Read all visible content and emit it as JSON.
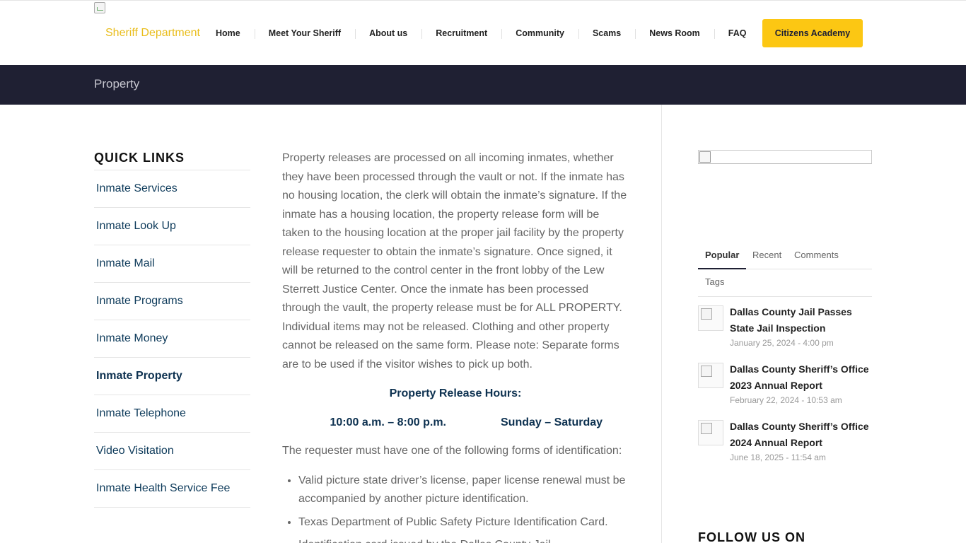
{
  "header": {
    "logo_text": "Sheriff Department",
    "nav": [
      "Home",
      "Meet Your Sheriff",
      "About us",
      "Recruitment",
      "Community",
      "Scams",
      "News Room",
      "FAQ"
    ],
    "cta_label": "Citizens Academy",
    "accent_color": "#fcc713"
  },
  "titlebar": {
    "title": "Property",
    "background": "#1f2033"
  },
  "quick_links": {
    "heading": "QUICK LINKS",
    "items": [
      "Inmate Services",
      "Inmate Look Up",
      "Inmate Mail",
      "Inmate Programs",
      "Inmate Money",
      "Inmate Property",
      "Inmate Telephone",
      "Video Visitation",
      "Inmate Health Service Fee"
    ],
    "active": "Inmate Property"
  },
  "content": {
    "intro": "Property releases are processed on all incoming inmates, whether they have been processed through the vault or not. If the inmate has no housing location, the clerk will obtain the inmate’s signature. If the inmate has a housing location, the property release form will be taken to the housing location at the proper jail facility by the property release requester to obtain the inmate’s signature. Once signed, it will be returned to the control center in the front lobby of the Lew Sterrett Justice Center. Once the inmate has been processed through the vault, the property release must be for ALL PROPERTY. Individual items may not be released. Clothing and other property cannot be released on the same form. Please note: Separate forms are to be used if the visitor wishes to pick up both.",
    "hours_title": "Property Release Hours:",
    "hours_time": "10:00 a.m. – 8:00 p.m.",
    "hours_days": "Sunday – Saturday",
    "requirement": "The requester must have one of the following forms of identification:",
    "id_list": [
      "Valid picture state driver’s license, paper license renewal must be accompanied by another picture identification.",
      "Texas Department of Public Safety Picture Identification Card.",
      "Identification card issued by the Dallas County Jail."
    ]
  },
  "sidebar": {
    "tabs": [
      "Popular",
      "Recent",
      "Comments",
      "Tags"
    ],
    "posts": [
      {
        "title": "Dallas County Jail Passes State Jail Inspection",
        "date": "January 25, 2024 - 4:00 pm"
      },
      {
        "title": "Dallas County Sheriff’s Office 2023 Annual Report",
        "date": "February 22, 2024 - 10:53 am"
      },
      {
        "title": "Dallas County Sheriff’s Office 2024 Annual Report",
        "date": "June 18, 2025 - 11:54 am"
      }
    ],
    "follow_heading": "FOLLOW US ON"
  }
}
